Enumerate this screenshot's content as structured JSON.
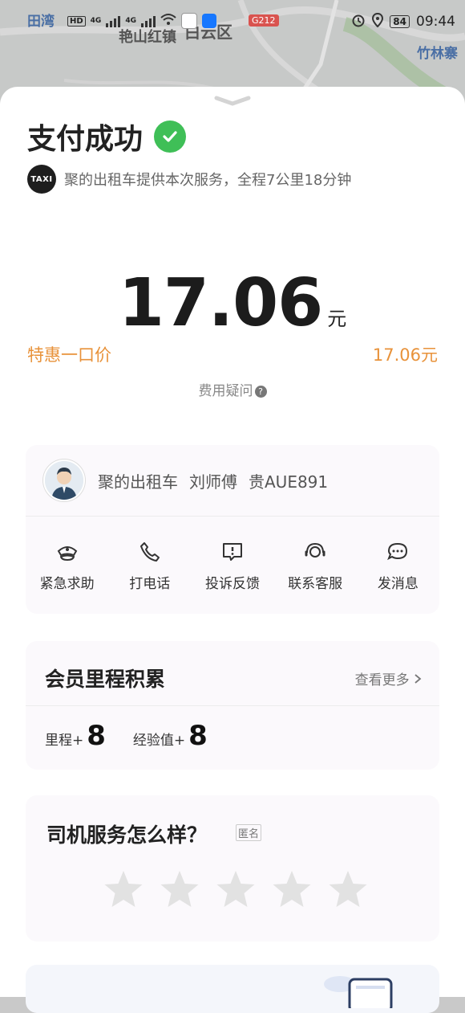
{
  "status_bar": {
    "time": "09:44",
    "battery": "84",
    "net_1": "HD",
    "net_2": "HD",
    "gen_1": "4G",
    "gen_2": "4G"
  },
  "map": {
    "label_tianwan": "田湾",
    "label_zhulinzhai": "竹林寨",
    "label_district": "白云区",
    "label_road": "G212",
    "label_park": "艳山红镇"
  },
  "sheet": {
    "title": "支付成功",
    "service_text": "聚的出租车提供本次服务，全程7公里18分钟",
    "taxi_logo_text": "TAXI",
    "amount": "17.06",
    "currency": "元",
    "price_label": "特惠一口价",
    "price_value": "17.06元",
    "fee_question": "费用疑问",
    "fee_question_mark": "?"
  },
  "driver": {
    "company": "聚的出租车",
    "name": "刘师傅",
    "plate": "贵AUE891"
  },
  "actions": [
    {
      "label": "紧急求助",
      "icon": "police-cap-icon"
    },
    {
      "label": "打电话",
      "icon": "phone-icon"
    },
    {
      "label": "投诉反馈",
      "icon": "complaint-icon"
    },
    {
      "label": "联系客服",
      "icon": "customer-service-icon"
    },
    {
      "label": "发消息",
      "icon": "message-icon"
    }
  ],
  "miles": {
    "title": "会员里程积累",
    "more": "查看更多",
    "mileage_label": "里程+",
    "mileage_value": "8",
    "exp_label": "经验值+",
    "exp_value": "8"
  },
  "rating": {
    "title": "司机服务怎么样？",
    "anonymous": "匿名",
    "stars_selected": 0,
    "stars_total": 5
  },
  "colors": {
    "accent_orange": "#e8923a",
    "success_green": "#3fbf57",
    "star_gray": "#e2e2e2"
  }
}
